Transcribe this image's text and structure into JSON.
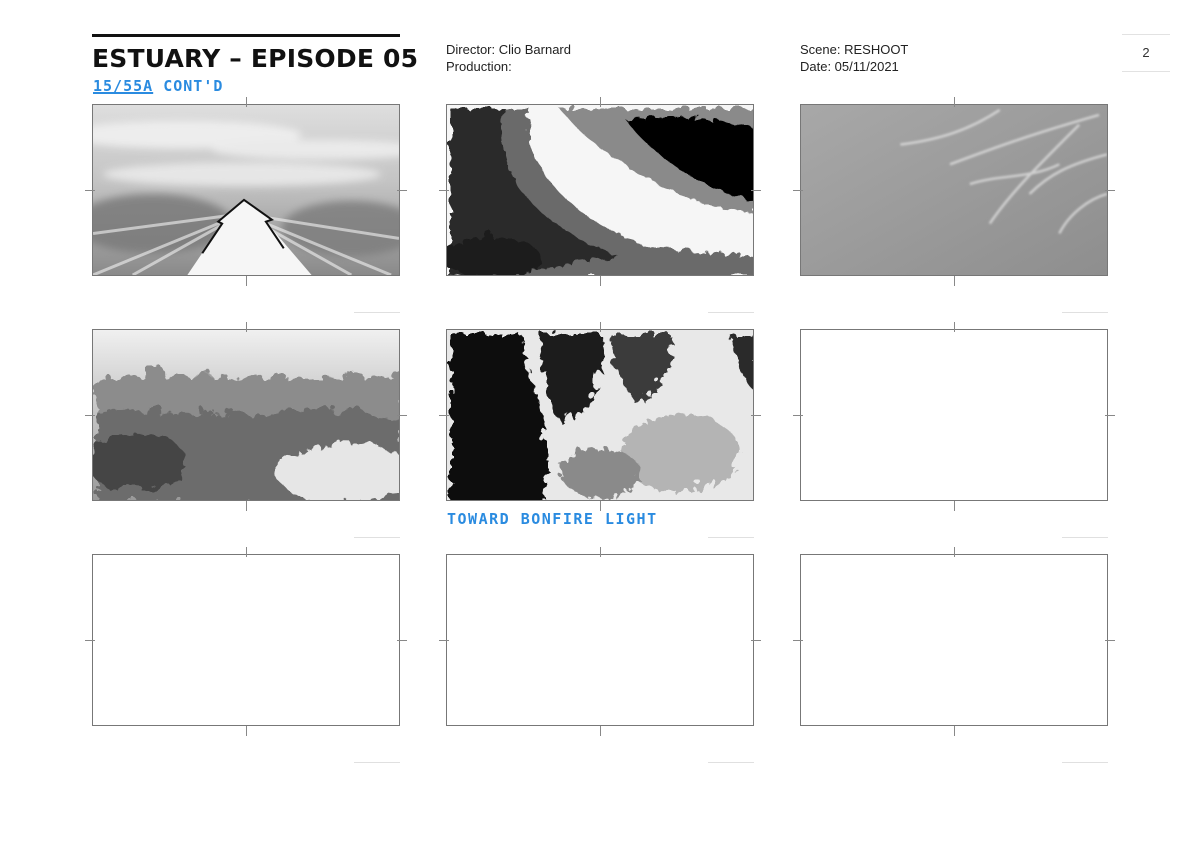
{
  "header": {
    "title": "ESTUARY – EPISODE 05",
    "shot_number": "15/55A",
    "shot_suffix": "CONT'D",
    "director": "Director: Clio Barnard",
    "production": "Production:",
    "scene": "Scene: RESHOOT",
    "date": "Date: 05/11/2021",
    "page_number": "2"
  },
  "panels": [
    {
      "id": "1",
      "content": "sky-with-arrow-sketch"
    },
    {
      "id": "2",
      "content": "ink-wash-dark-curve-sketch"
    },
    {
      "id": "3",
      "content": "grey-branch-texture-sketch"
    },
    {
      "id": "4",
      "content": "misty-treeline-sketch"
    },
    {
      "id": "5",
      "content": "ink-foliage-sketch",
      "note": "TOWARD BONFIRE LIGHT"
    },
    {
      "id": "6",
      "content": "empty"
    },
    {
      "id": "7",
      "content": "empty"
    },
    {
      "id": "8",
      "content": "empty"
    },
    {
      "id": "9",
      "content": "empty"
    }
  ],
  "colors": {
    "annotation": "#2a8be0",
    "frame": "#777777"
  }
}
